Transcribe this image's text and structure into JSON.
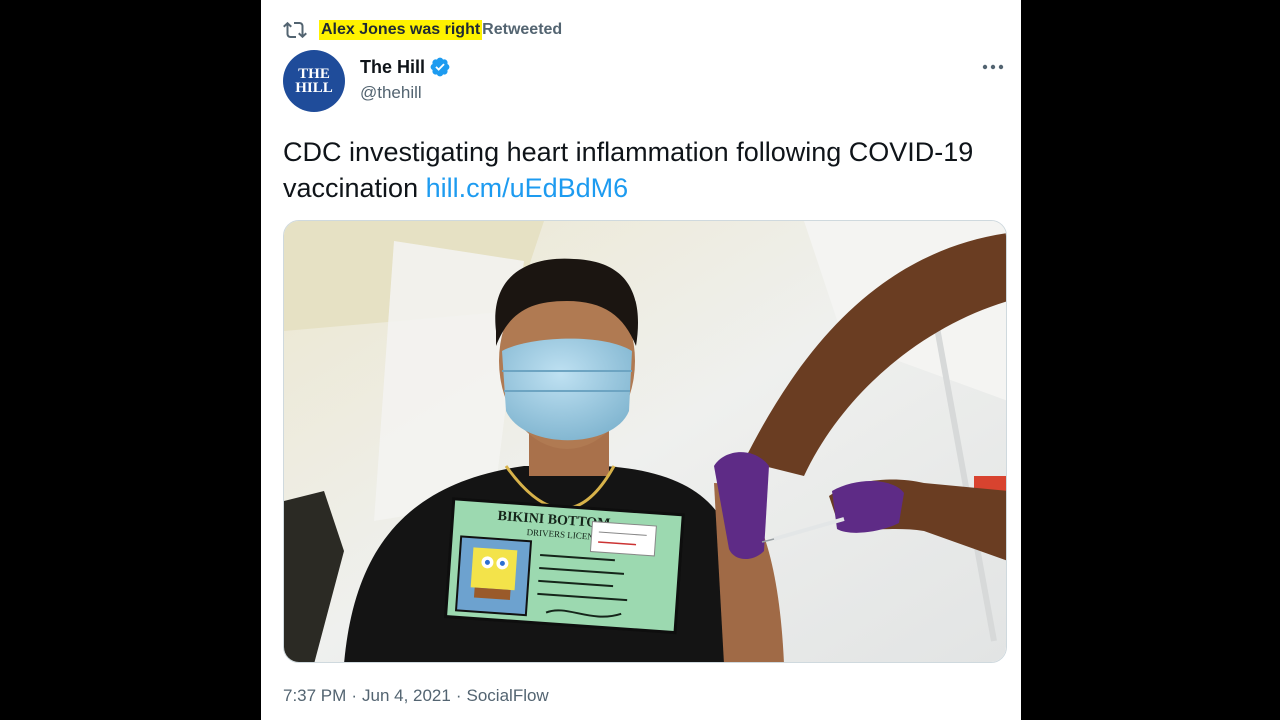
{
  "retweet": {
    "icon": "retweet-icon",
    "user": "Alex Jones was right",
    "label": "Retweeted",
    "highlight_color": "#fff200"
  },
  "author": {
    "avatar_line1": "THE",
    "avatar_line2": "HILL",
    "avatar_color": "#1f4c9a",
    "name": "The Hill",
    "verified_icon": "verified-badge-icon",
    "verified_color": "#1d9bf0",
    "handle": "@thehill"
  },
  "more_icon": "more-horizontal-icon",
  "tweet": {
    "text": "CDC investigating heart inflammation following COVID-19 vaccination ",
    "link": "hill.cm/uEdBdM6",
    "link_color": "#1d9bf0"
  },
  "media": {
    "shirt_title": "BIKINI BOTTOM",
    "shirt_subtitle": "DRIVERS LICENSE"
  },
  "meta": {
    "time": "7:37 PM",
    "separator": "·",
    "date": "Jun 4, 2021",
    "source": "SocialFlow"
  }
}
